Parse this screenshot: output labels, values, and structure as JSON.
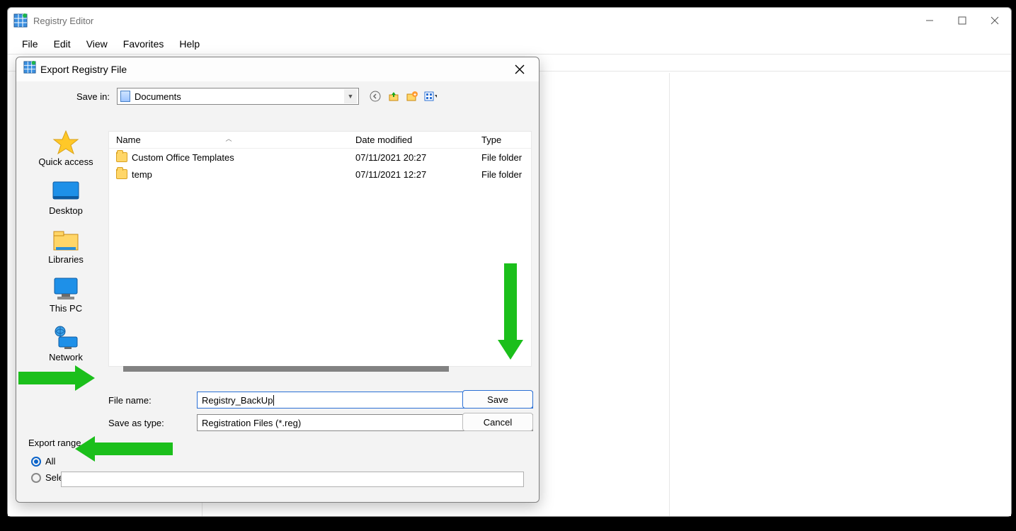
{
  "main_window": {
    "title": "Registry Editor",
    "menu": [
      "File",
      "Edit",
      "View",
      "Favorites",
      "Help"
    ]
  },
  "dialog": {
    "title": "Export Registry File",
    "savein_label": "Save in:",
    "savein_value": "Documents",
    "columns": {
      "name": "Name",
      "date": "Date modified",
      "type": "Type"
    },
    "rows": [
      {
        "name": "Custom Office Templates",
        "date": "07/11/2021 20:27",
        "type": "File folder"
      },
      {
        "name": "temp",
        "date": "07/11/2021 12:27",
        "type": "File folder"
      }
    ],
    "filename_label": "File name:",
    "filename_value": "Registry_BackUp",
    "saveastype_label": "Save as type:",
    "saveastype_value": "Registration Files (*.reg)",
    "btn_save": "Save",
    "btn_cancel": "Cancel",
    "places": {
      "quick": "Quick access",
      "desktop": "Desktop",
      "libraries": "Libraries",
      "thispc": "This PC",
      "network": "Network"
    },
    "export_range": {
      "legend": "Export range",
      "opt_all": "All",
      "opt_selected": "Selected branch"
    }
  }
}
